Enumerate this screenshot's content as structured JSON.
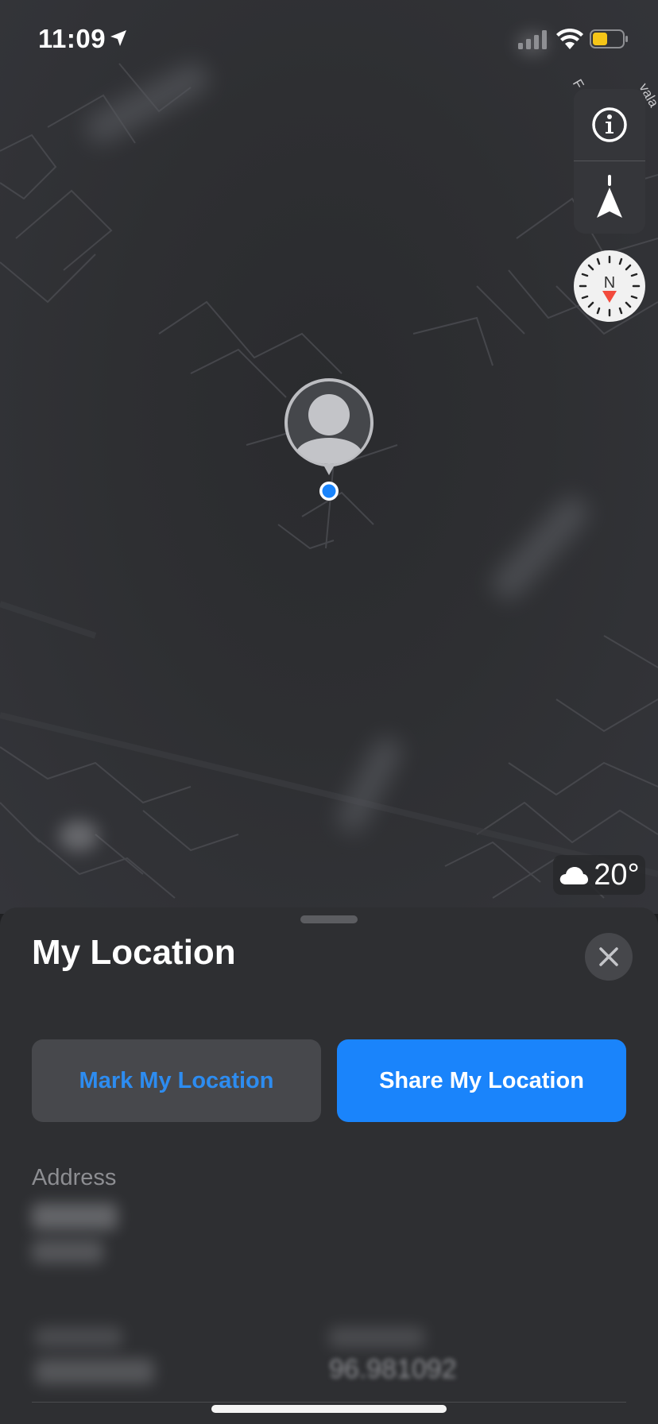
{
  "status_bar": {
    "time": "11:09",
    "icons": [
      "location-arrow-icon",
      "cellular-signal-icon",
      "wifi-icon",
      "battery-low-icon"
    ],
    "battery_color": "#f5c518"
  },
  "map": {
    "street_labels": [
      "F",
      "vala Ro"
    ],
    "blurred_place_label": "Bhagwan Mansion",
    "controls": [
      "info-icon",
      "location-arrow-icon"
    ],
    "compass_letter": "N",
    "compass_needle_color": "#f24a3c",
    "user_location_color": "#1a84fb"
  },
  "weather": {
    "icon": "cloud-icon",
    "temperature": "20°"
  },
  "sheet": {
    "title": "My Location",
    "close_icon": "close-icon",
    "mark_button": "Mark My Location",
    "share_button": "Share My Location",
    "address_label": "Address",
    "coordinate_partial": "96.981092"
  },
  "colors": {
    "accent": "#1a84fb",
    "sheet_bg": "#2e2f32"
  }
}
